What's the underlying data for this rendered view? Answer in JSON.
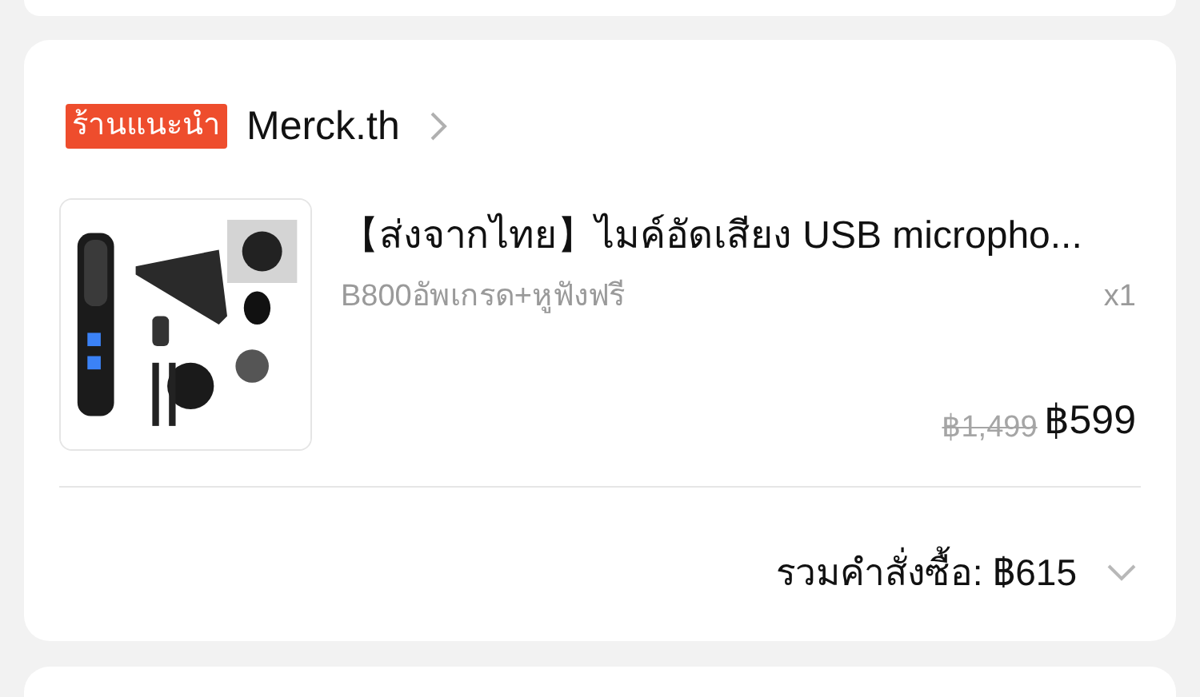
{
  "shop": {
    "badge": "ร้านแนะนำ",
    "name": "Merck.th"
  },
  "item": {
    "title": "【ส่งจากไทย】ไมค์อัดเสียง USB micropho...",
    "variant": "B800อัพเกรด+หูฟังฟรี",
    "quantity": "x1",
    "original_price": "฿1,499",
    "price": "฿599"
  },
  "total": {
    "label": "รวมคำสั่งซื้อ: ฿615"
  }
}
